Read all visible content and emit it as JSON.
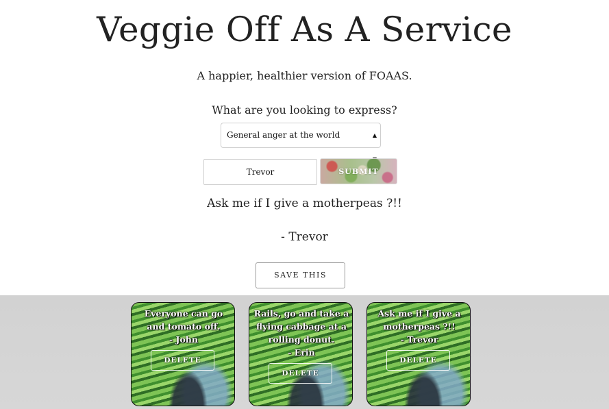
{
  "header": {
    "title": "Veggie Off As A Service",
    "subtitle": "A happier, healthier version of FOAAS."
  },
  "form": {
    "prompt": "What are you looking to express?",
    "select": {
      "selected": "General anger at the world",
      "caret_icon": "updown-caret-icon"
    },
    "name_input": {
      "value": "Trevor"
    },
    "submit_label": "SUBMIT"
  },
  "result": {
    "message": "Ask me if I give a motherpeas ?!!",
    "author": "- Trevor",
    "save_label": "SAVE THIS"
  },
  "saved": {
    "cards": [
      {
        "message": "Everyone can go and tomato off.",
        "author": "- John",
        "delete_label": "DELETE"
      },
      {
        "message": "Rails, go and take a flying cabbage at a rolling donut.",
        "author": "- Erin",
        "delete_label": "DELETE"
      },
      {
        "message": "Ask me if I give a motherpeas ?!!",
        "author": "- Trevor",
        "delete_label": "DELETE"
      }
    ]
  }
}
